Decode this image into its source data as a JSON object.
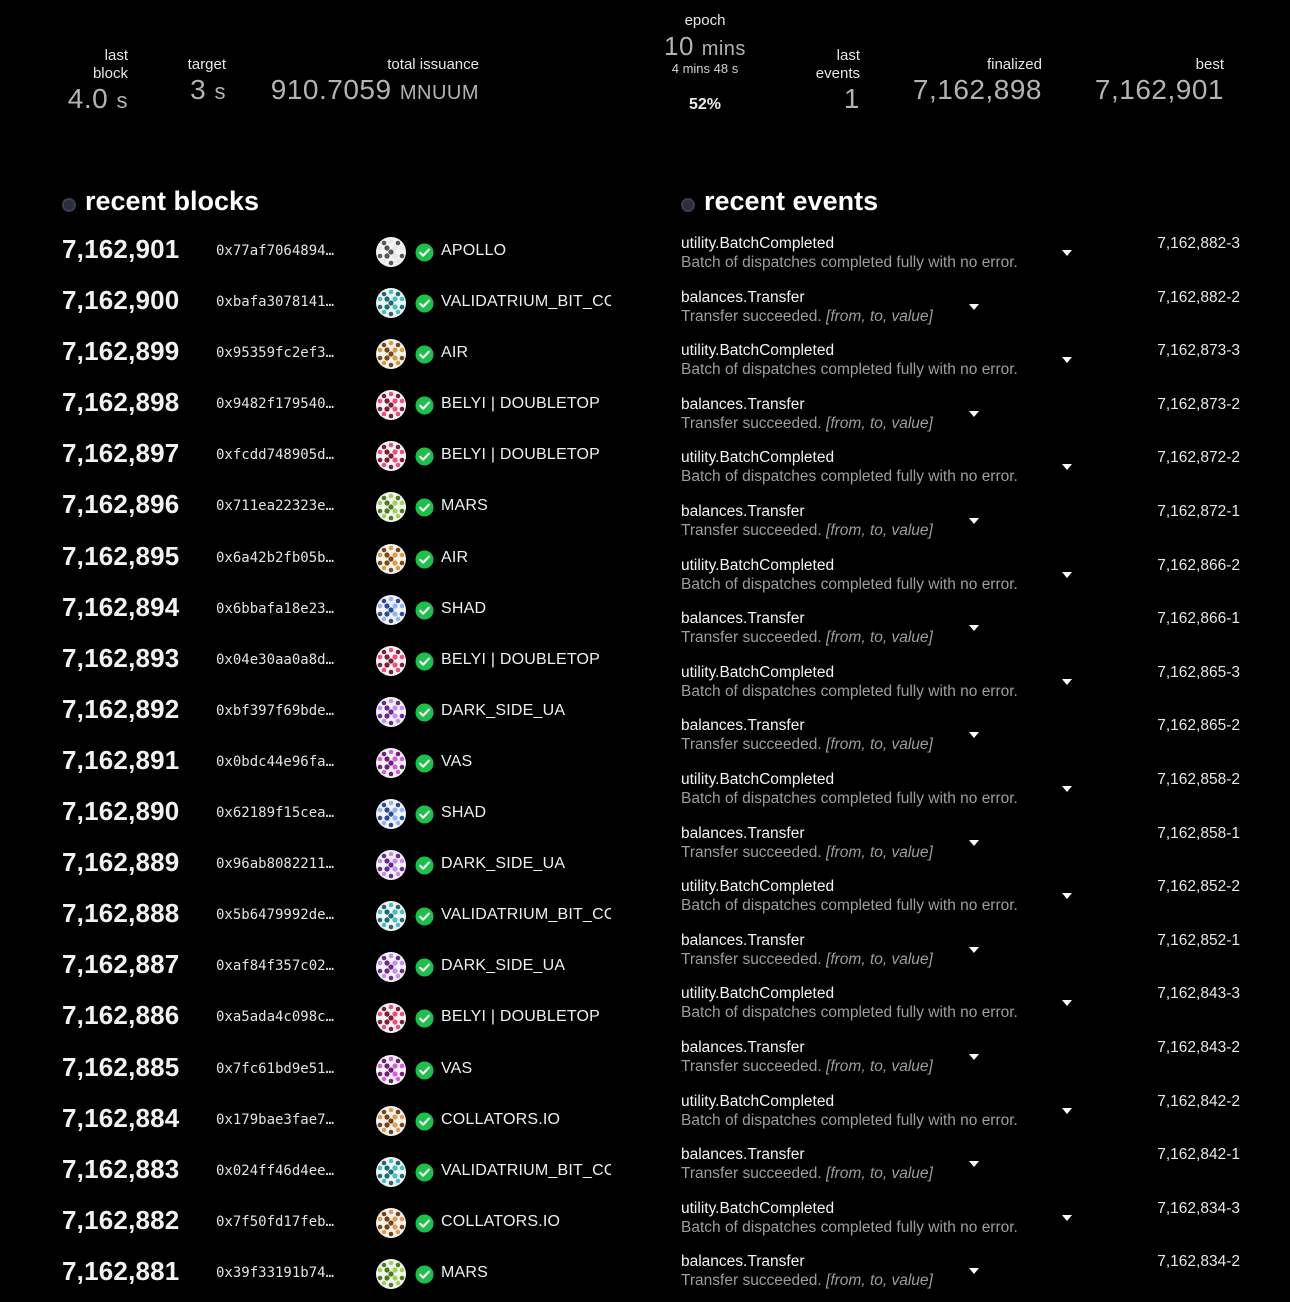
{
  "summary": {
    "last_block": {
      "label_line1": "last",
      "label_line2": "block",
      "value": "4.0",
      "unit": "s"
    },
    "target": {
      "label": "target",
      "value": "3",
      "unit": "s"
    },
    "total_issuance": {
      "label": "total issuance",
      "value": "910.7059",
      "unit": "MNUUM"
    },
    "epoch": {
      "label": "epoch",
      "value": "10",
      "unit": "mins",
      "remaining": "4 mins 48 s",
      "progress": "52%"
    },
    "last_events": {
      "label_line1": "last",
      "label_line2": "events",
      "value": "1"
    },
    "finalized": {
      "label": "finalized",
      "value": "7,162,898"
    },
    "best": {
      "label": "best",
      "value": "7,162,901"
    }
  },
  "recent_blocks": {
    "title": "recent blocks",
    "rows": [
      {
        "number": "7,162,901",
        "hash": "0x77af7064894…",
        "author": "APOLLO",
        "identicon": "apollo",
        "colors": [
          "#e6e6e6",
          "#555555"
        ]
      },
      {
        "number": "7,162,900",
        "hash": "0xbafa3078141…",
        "author": "VALIDATRIUM_BIT_CO",
        "identicon": "validatrium",
        "colors": [
          "#43c1c4",
          "#1d6b76"
        ]
      },
      {
        "number": "7,162,899",
        "hash": "0x95359fc2ef3…",
        "author": "AIR",
        "identicon": "air",
        "colors": [
          "#e39b3a",
          "#7a4a12"
        ]
      },
      {
        "number": "7,162,898",
        "hash": "0x9482f179540…",
        "author": "BELYI | DOUBLETOP",
        "identicon": "belyi",
        "colors": [
          "#ec4f79",
          "#7c1e38"
        ]
      },
      {
        "number": "7,162,897",
        "hash": "0xfcdd748905d…",
        "author": "BELYI | DOUBLETOP",
        "identicon": "belyi",
        "colors": [
          "#ec4f79",
          "#7c1e38"
        ]
      },
      {
        "number": "7,162,896",
        "hash": "0x711ea22323e…",
        "author": "MARS",
        "identicon": "mars",
        "colors": [
          "#9bd64f",
          "#4e7a1e"
        ]
      },
      {
        "number": "7,162,895",
        "hash": "0x6a42b2fb05b…",
        "author": "AIR",
        "identicon": "air",
        "colors": [
          "#e39b3a",
          "#7a4a12"
        ]
      },
      {
        "number": "7,162,894",
        "hash": "0x6bbafa18e23…",
        "author": "SHAD",
        "identicon": "shad",
        "colors": [
          "#8fb3ff",
          "#2c4a9a"
        ]
      },
      {
        "number": "7,162,893",
        "hash": "0x04e30aa0a8d…",
        "author": "BELYI | DOUBLETOP",
        "identicon": "belyi",
        "colors": [
          "#ec4f79",
          "#7c1e38"
        ]
      },
      {
        "number": "7,162,892",
        "hash": "0xbf397f69bde…",
        "author": "DARK_SIDE_UA",
        "identicon": "darkside",
        "colors": [
          "#c98cf2",
          "#6a2a8f"
        ]
      },
      {
        "number": "7,162,891",
        "hash": "0x0bdc44e96fa…",
        "author": "VAS",
        "identicon": "vas",
        "colors": [
          "#d95be0",
          "#6c1f74"
        ]
      },
      {
        "number": "7,162,890",
        "hash": "0x62189f15cea…",
        "author": "SHAD",
        "identicon": "shad",
        "colors": [
          "#8fb3ff",
          "#2c4a9a"
        ]
      },
      {
        "number": "7,162,889",
        "hash": "0x96ab8082211…",
        "author": "DARK_SIDE_UA",
        "identicon": "darkside",
        "colors": [
          "#c98cf2",
          "#6a2a8f"
        ]
      },
      {
        "number": "7,162,888",
        "hash": "0x5b6479992de…",
        "author": "VALIDATRIUM_BIT_CO",
        "identicon": "validatrium",
        "colors": [
          "#43c1c4",
          "#1d6b76"
        ]
      },
      {
        "number": "7,162,887",
        "hash": "0xaf84f357c02…",
        "author": "DARK_SIDE_UA",
        "identicon": "darkside",
        "colors": [
          "#c98cf2",
          "#6a2a8f"
        ]
      },
      {
        "number": "7,162,886",
        "hash": "0xa5ada4c098c…",
        "author": "BELYI | DOUBLETOP",
        "identicon": "belyi",
        "colors": [
          "#ec4f79",
          "#7c1e38"
        ]
      },
      {
        "number": "7,162,885",
        "hash": "0x7fc61bd9e51…",
        "author": "VAS",
        "identicon": "vas",
        "colors": [
          "#d95be0",
          "#6c1f74"
        ]
      },
      {
        "number": "7,162,884",
        "hash": "0x179bae3fae7…",
        "author": "COLLATORS.IO",
        "identicon": "collators",
        "colors": [
          "#e59a4d",
          "#7b3f13"
        ]
      },
      {
        "number": "7,162,883",
        "hash": "0x024ff46d4ee…",
        "author": "VALIDATRIUM_BIT_CO",
        "identicon": "validatrium",
        "colors": [
          "#43c1c4",
          "#1d6b76"
        ]
      },
      {
        "number": "7,162,882",
        "hash": "0x7f50fd17feb…",
        "author": "COLLATORS.IO",
        "identicon": "collators",
        "colors": [
          "#e59a4d",
          "#7b3f13"
        ]
      },
      {
        "number": "7,162,881",
        "hash": "0x39f33191b74…",
        "author": "MARS",
        "identicon": "mars",
        "colors": [
          "#9bd64f",
          "#4e7a1e"
        ]
      }
    ]
  },
  "recent_events": {
    "title": "recent events",
    "rows": [
      {
        "name": "utility.BatchCompleted",
        "desc": "Batch of dispatches completed fully with no error.",
        "args": "",
        "id": "7,162,882-3"
      },
      {
        "name": "balances.Transfer",
        "desc": "Transfer succeeded.",
        "args": "[from, to, value]",
        "id": "7,162,882-2"
      },
      {
        "name": "utility.BatchCompleted",
        "desc": "Batch of dispatches completed fully with no error.",
        "args": "",
        "id": "7,162,873-3"
      },
      {
        "name": "balances.Transfer",
        "desc": "Transfer succeeded.",
        "args": "[from, to, value]",
        "id": "7,162,873-2"
      },
      {
        "name": "utility.BatchCompleted",
        "desc": "Batch of dispatches completed fully with no error.",
        "args": "",
        "id": "7,162,872-2"
      },
      {
        "name": "balances.Transfer",
        "desc": "Transfer succeeded.",
        "args": "[from, to, value]",
        "id": "7,162,872-1"
      },
      {
        "name": "utility.BatchCompleted",
        "desc": "Batch of dispatches completed fully with no error.",
        "args": "",
        "id": "7,162,866-2"
      },
      {
        "name": "balances.Transfer",
        "desc": "Transfer succeeded.",
        "args": "[from, to, value]",
        "id": "7,162,866-1"
      },
      {
        "name": "utility.BatchCompleted",
        "desc": "Batch of dispatches completed fully with no error.",
        "args": "",
        "id": "7,162,865-3"
      },
      {
        "name": "balances.Transfer",
        "desc": "Transfer succeeded.",
        "args": "[from, to, value]",
        "id": "7,162,865-2"
      },
      {
        "name": "utility.BatchCompleted",
        "desc": "Batch of dispatches completed fully with no error.",
        "args": "",
        "id": "7,162,858-2"
      },
      {
        "name": "balances.Transfer",
        "desc": "Transfer succeeded.",
        "args": "[from, to, value]",
        "id": "7,162,858-1"
      },
      {
        "name": "utility.BatchCompleted",
        "desc": "Batch of dispatches completed fully with no error.",
        "args": "",
        "id": "7,162,852-2"
      },
      {
        "name": "balances.Transfer",
        "desc": "Transfer succeeded.",
        "args": "[from, to, value]",
        "id": "7,162,852-1"
      },
      {
        "name": "utility.BatchCompleted",
        "desc": "Batch of dispatches completed fully with no error.",
        "args": "",
        "id": "7,162,843-3"
      },
      {
        "name": "balances.Transfer",
        "desc": "Transfer succeeded.",
        "args": "[from, to, value]",
        "id": "7,162,843-2"
      },
      {
        "name": "utility.BatchCompleted",
        "desc": "Batch of dispatches completed fully with no error.",
        "args": "",
        "id": "7,162,842-2"
      },
      {
        "name": "balances.Transfer",
        "desc": "Transfer succeeded.",
        "args": "[from, to, value]",
        "id": "7,162,842-1"
      },
      {
        "name": "utility.BatchCompleted",
        "desc": "Batch of dispatches completed fully with no error.",
        "args": "",
        "id": "7,162,834-3"
      },
      {
        "name": "balances.Transfer",
        "desc": "Transfer succeeded.",
        "args": "[from, to, value]",
        "id": "7,162,834-2"
      }
    ]
  },
  "colors": {
    "background": "#000000",
    "success": "#1fbf4b",
    "muted_text": "#9d9d9d"
  }
}
